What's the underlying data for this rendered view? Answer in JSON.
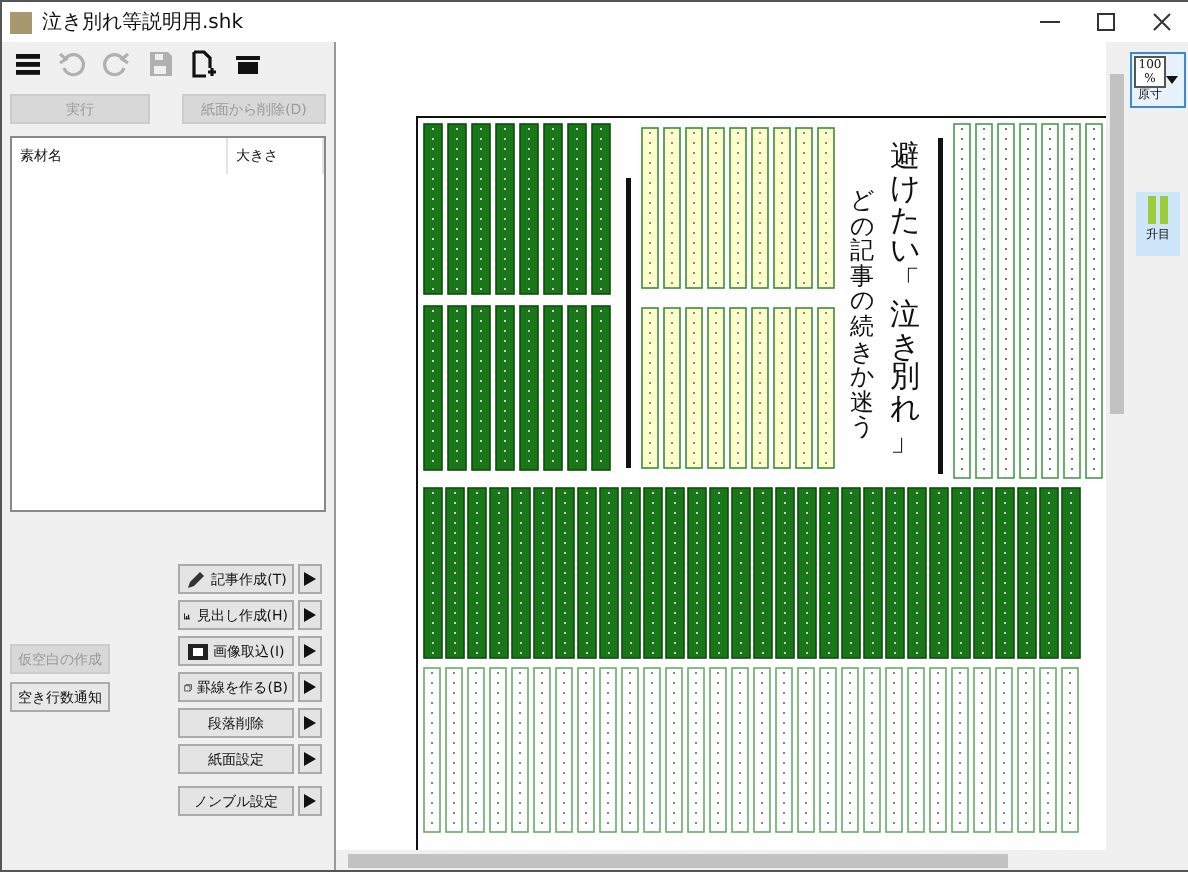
{
  "window": {
    "title": "泣き別れ等説明用.shk"
  },
  "toolbar": [
    {
      "kind": "menu",
      "disabled": false
    },
    {
      "kind": "undo",
      "disabled": true
    },
    {
      "kind": "redo",
      "disabled": true
    },
    {
      "kind": "save",
      "disabled": true
    },
    {
      "kind": "new",
      "disabled": false
    },
    {
      "kind": "tray",
      "disabled": false
    }
  ],
  "top_buttons": [
    {
      "label": "実行",
      "disabled": true
    },
    {
      "label": "紙面から削除(D)",
      "disabled": true
    }
  ],
  "material_list": {
    "columns": [
      "素材名",
      "大きさ"
    ]
  },
  "side_buttons": [
    {
      "label": "仮空白の作成",
      "disabled": true
    },
    {
      "label": "空き行数通知",
      "disabled": false
    }
  ],
  "tool_buttons": [
    {
      "label": "記事作成(T)",
      "kind": "pencil"
    },
    {
      "label": "見出し作成(H)",
      "kind": "bars"
    },
    {
      "label": "画像取込(I)",
      "kind": "image"
    },
    {
      "label": "罫線を作る(B)",
      "kind": "frame"
    },
    {
      "label": "段落削除",
      "kind": "plain"
    },
    {
      "label": "紙面設定",
      "kind": "plain"
    },
    {
      "label": "ノンブル設定",
      "kind": "plain"
    }
  ],
  "page": {
    "headline": "避けたい「泣き別れ」",
    "subheadline": "どの記事の続きか迷う"
  },
  "zoom": {
    "value": "100",
    "unit": "%",
    "label": "原寸"
  },
  "grid_toggle": {
    "label": "升目",
    "on": true
  }
}
